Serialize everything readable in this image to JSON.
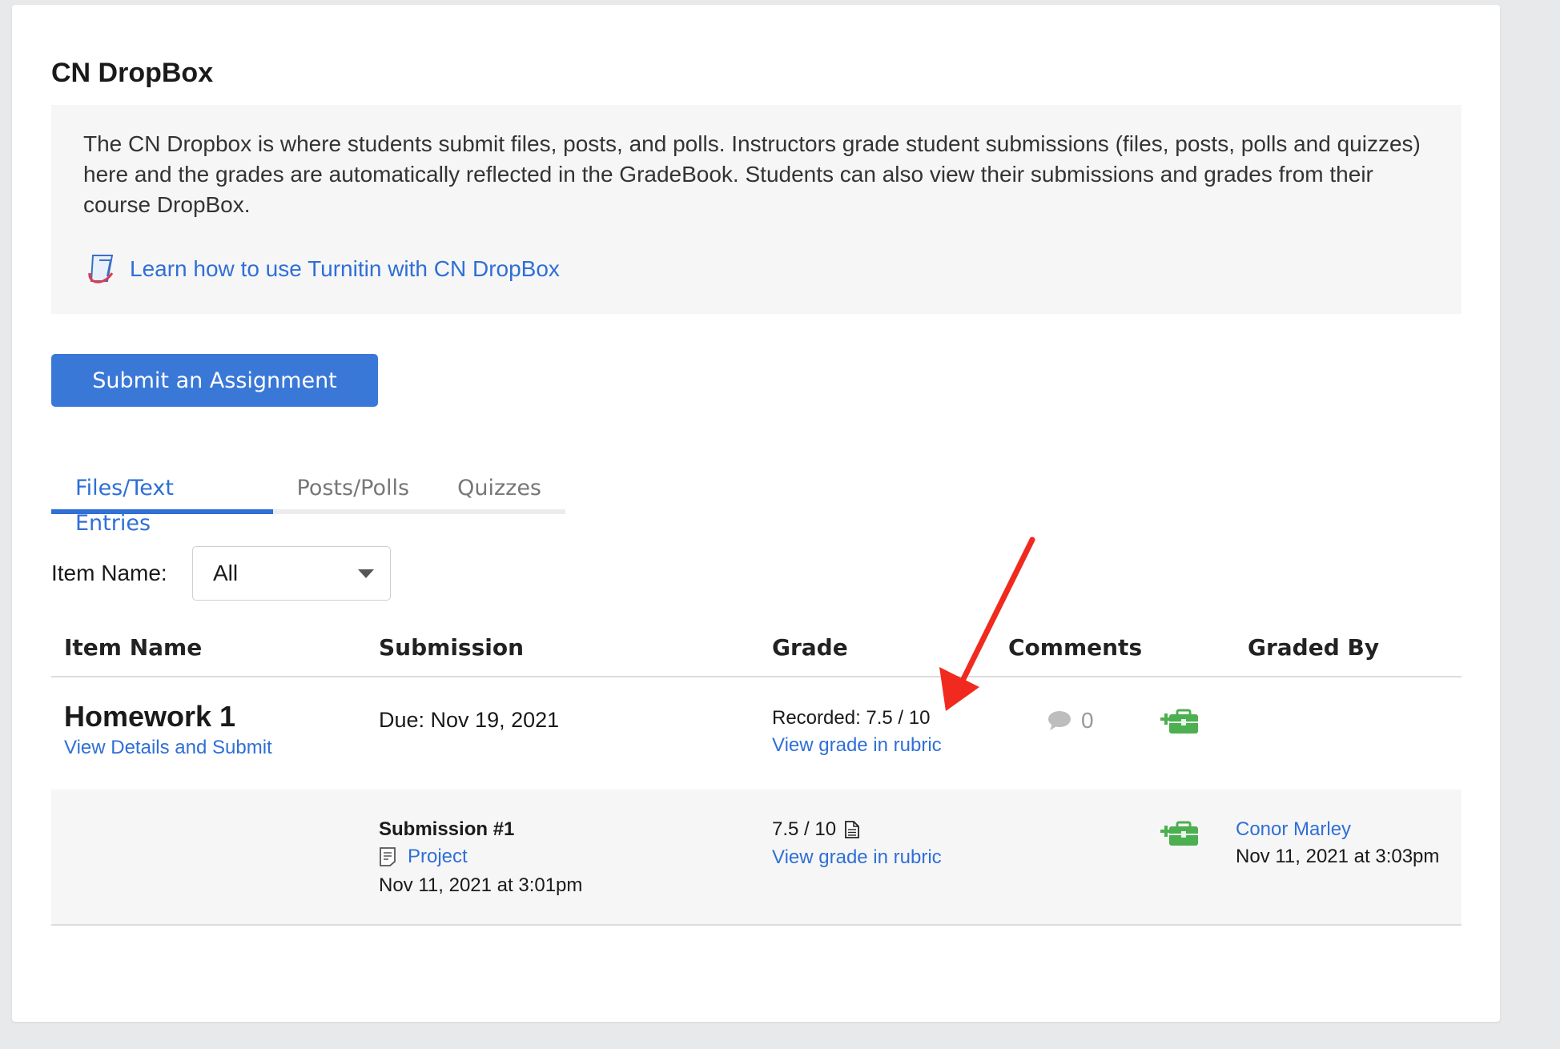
{
  "page": {
    "title": "CN DropBox",
    "description": "The CN Dropbox is where students submit files, posts, and polls. Instructors grade student submissions (files, posts, polls and quizzes) here and the grades are automatically reflected in the GradeBook. Students can also view their submissions and grades from their course DropBox.",
    "turnitin_link": "Learn how to use Turnitin with CN DropBox",
    "submit_button": "Submit an Assignment"
  },
  "tabs": [
    {
      "label": "Files/Text Entries",
      "active": true
    },
    {
      "label": "Posts/Polls",
      "active": false
    },
    {
      "label": "Quizzes",
      "active": false
    }
  ],
  "filter": {
    "label": "Item Name:",
    "selected": "All"
  },
  "table": {
    "headers": [
      "Item Name",
      "Submission",
      "Grade",
      "Comments",
      "Graded By"
    ],
    "item": {
      "name": "Homework 1",
      "link": "View Details and Submit",
      "due": "Due: Nov 19, 2021",
      "grade": "Recorded: 7.5 / 10",
      "grade_link": "View grade in rubric",
      "comments": "0"
    },
    "submission": {
      "title": "Submission #1",
      "file": "Project",
      "date": "Nov 11, 2021 at 3:01pm",
      "grade": "7.5 / 10",
      "grade_link": "View grade in rubric",
      "graded_by": "Conor Marley",
      "graded_date": "Nov 11, 2021 at 3:03pm"
    }
  },
  "colors": {
    "accent": "#3a78d8",
    "link": "#2f6fd6",
    "annotation_arrow": "#f02a1e",
    "grade_icon": "#4caf50"
  }
}
